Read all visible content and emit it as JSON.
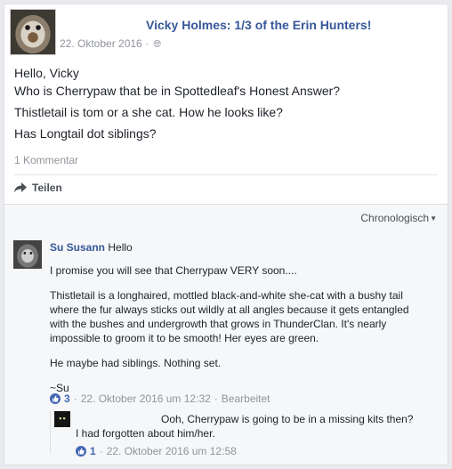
{
  "post": {
    "title": "Vicky Holmes: 1/3 of the Erin Hunters!",
    "date": "22. Oktober 2016",
    "meta_separator": "·",
    "lines": [
      "Hello, Vicky",
      "Who is Cherrypaw that be in Spottedleaf's Honest Answer?",
      "Thistletail is tom or a she cat. How he looks like?",
      "Has Longtail dot siblings?"
    ],
    "comment_count": "1 Kommentar",
    "share_label": "Teilen"
  },
  "comments": {
    "sort_label": "Chronologisch",
    "main": {
      "author": "Su Susann",
      "greeting": "Hello",
      "paragraph1": "I promise you will see that Cherrypaw VERY soon....",
      "paragraph2": "Thistletail is a longhaired, mottled black-and-white she-cat with a bushy tail where the fur always sticks out wildly at all angles because it gets entangled with the bushes and undergrowth that grows in ThunderClan. It's nearly impossible to groom it to be smooth! Her eyes are green.",
      "paragraph3": "He maybe had siblings. Nothing set.",
      "signature": "~Su",
      "likes": "3",
      "timestamp": "22. Oktober 2016 um 12:32",
      "separator": "·",
      "edited": "Bearbeitet"
    },
    "reply": {
      "line1": "Ooh, Cherrypaw is going to be in a missing kits then?",
      "line2": "I had forgotten about him/her.",
      "likes": "1",
      "separator": "·",
      "timestamp": "22. Oktober 2016 um 12:58"
    }
  },
  "colors": {
    "link_blue": "#365899",
    "like_blue": "#4267b2",
    "meta_gray": "#90949c",
    "background": "#e9ebee"
  },
  "icons": {
    "share": "share-arrow-icon",
    "globe": "globe-icon",
    "like": "thumbs-up-icon",
    "sort": "caret-down-icon"
  }
}
